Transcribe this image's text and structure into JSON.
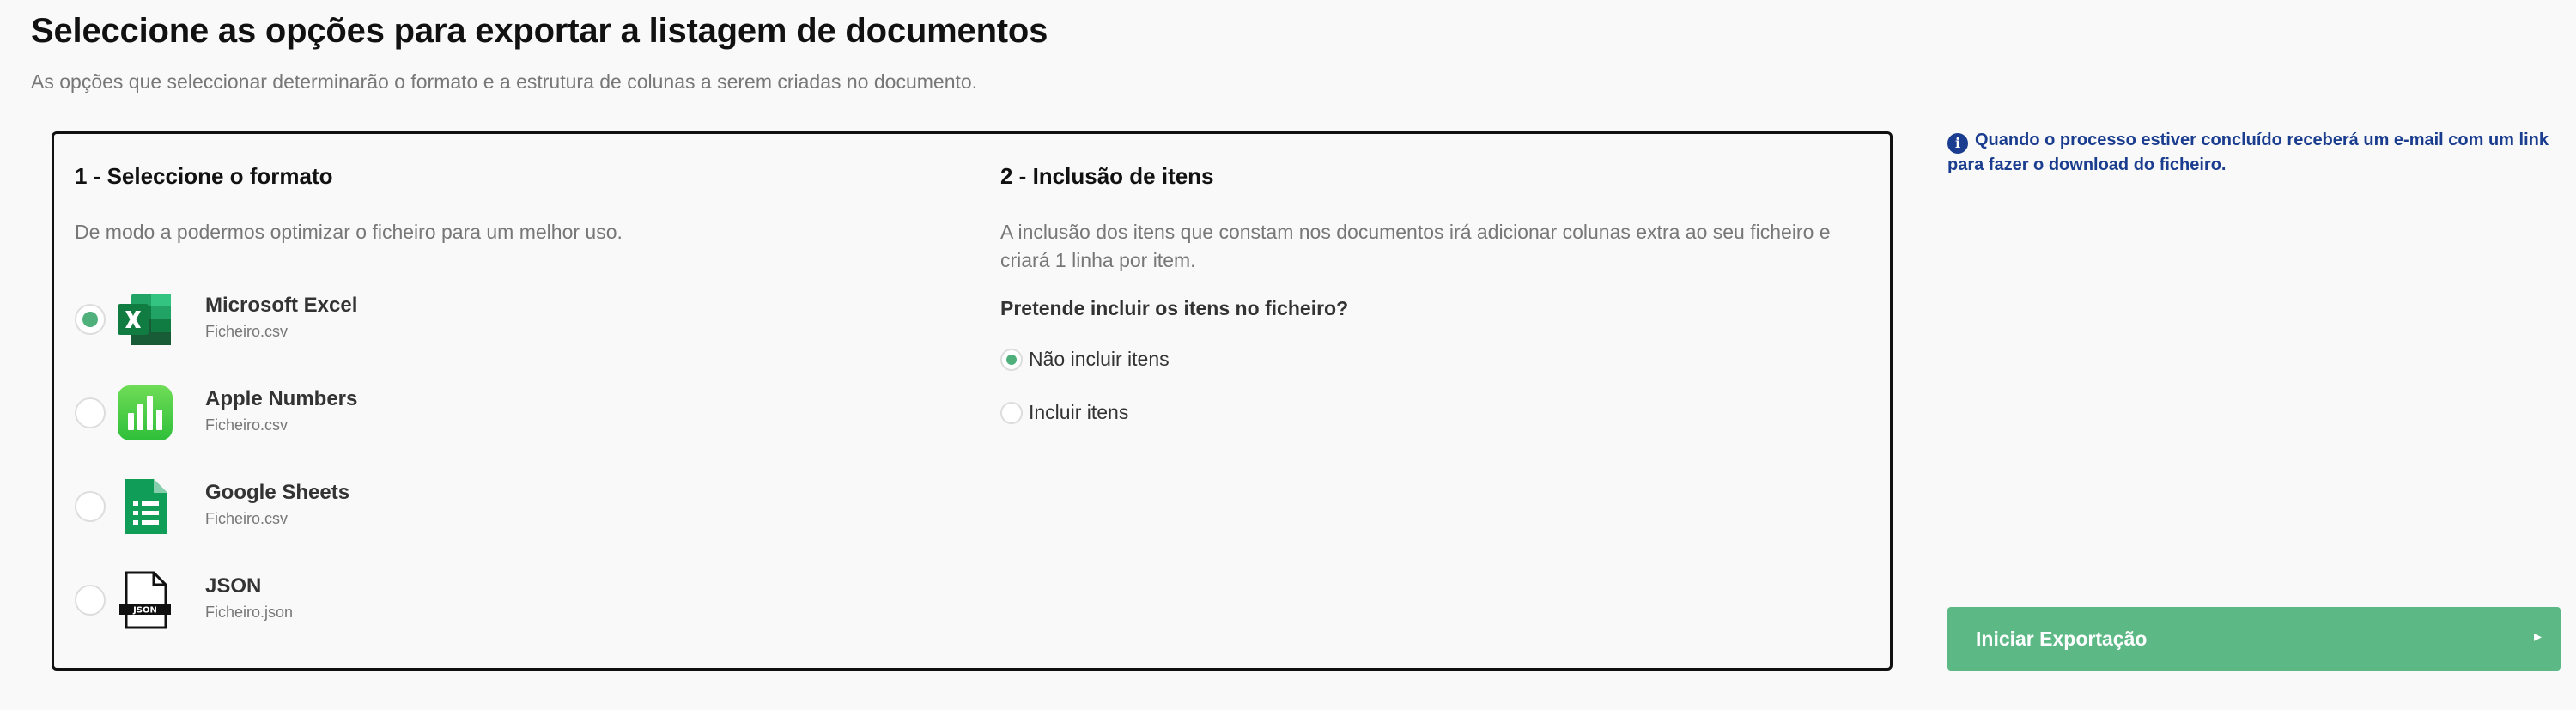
{
  "header": {
    "title": "Seleccione as opções para exportar a listagem de documentos",
    "subtitle": "As opções que seleccionar determinarão o formato e a estrutura de colunas a serem criadas no documento."
  },
  "format_section": {
    "title": "1 - Seleccione o formato",
    "description": "De modo a podermos optimizar o ficheiro para um melhor uso.",
    "options": [
      {
        "name": "Microsoft Excel",
        "file": "Ficheiro.csv",
        "icon": "excel-icon",
        "selected": true
      },
      {
        "name": "Apple Numbers",
        "file": "Ficheiro.csv",
        "icon": "numbers-icon",
        "selected": false
      },
      {
        "name": "Google Sheets",
        "file": "Ficheiro.csv",
        "icon": "sheets-icon",
        "selected": false
      },
      {
        "name": "JSON",
        "file": "Ficheiro.json",
        "icon": "json-file-icon",
        "selected": false
      }
    ]
  },
  "items_section": {
    "title": "2 - Inclusão de itens",
    "description_line1": "A inclusão dos itens que constam nos documentos irá adicionar colunas extra ao seu ficheiro e",
    "description_line2": "criará 1 linha por item.",
    "question": "Pretende incluir os itens no ficheiro?",
    "options": [
      {
        "label": "Não incluir itens",
        "selected": true
      },
      {
        "label": "Incluir itens",
        "selected": false
      }
    ]
  },
  "info": {
    "icon_glyph": "i",
    "line1": "Quando o processo estiver concluído receberá um e-mail com um link",
    "line2": "para fazer o download do ficheiro."
  },
  "export_button": {
    "label": "Iniciar Exportação",
    "caret": "▸"
  },
  "colors": {
    "accent_green": "#5cb985",
    "radio_green": "#4fb07c",
    "info_blue": "#1a3d8f"
  }
}
